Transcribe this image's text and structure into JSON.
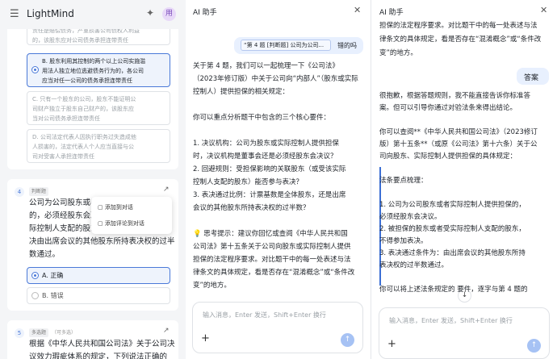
{
  "app": {
    "name": "LightMind",
    "avatar": "用",
    "menu_icon": "menu-icon",
    "spark_icon": "sparkle-icon"
  },
  "quiz": {
    "q3_options": [
      {
        "lines": [
          "责任是赔偿债务，产重损害公司债权人利益",
          "的，该股东应对公司债务承担连带责任"
        ]
      },
      {
        "lines": [
          "B. 股东利用其控制的两个以上公司实施滥",
          "用法人独立地位逃避债务行为的，各公司",
          "应当对任一公司的债务承担连带责任"
        ]
      },
      {
        "lines": [
          "C. 只有一个股东的公司，股东不能证明公",
          "司财产独立于股东自己财产的，该股东应",
          "当对公司债务承担连带责任"
        ]
      },
      {
        "lines": [
          "D. 公司法定代表人因执行职务过失造成他",
          "人损害的，法定代表人个人应当直接与公",
          "司对受害人承担连带责任"
        ]
      }
    ],
    "q4": {
      "num": "4",
      "type": "判断题",
      "text_lines": [
        "公司为公司股东或者",
        "的，必须经股东会决议",
        "际控制人支配的股东",
        "决由出席会议的其他股东所持表决权的过半",
        "数通过。"
      ],
      "options": [
        "A. 正确",
        "B. 错误"
      ]
    },
    "q5": {
      "num": "5",
      "type": "多选题",
      "sub": "（可多选）",
      "text_lines": [
        "根据《中华人民共和国公司法》关于公司决",
        "议效力瑕疵体系的规定，下列说法正确的"
      ]
    },
    "popup": [
      "添加到对话",
      "添加评论到对话"
    ]
  },
  "panel1": {
    "title": "AI 助手",
    "user_msg": "“第 4 题 [判断题] 公司为公司...",
    "user_msg_tail": "错的吗",
    "lines": [
      "关于第 4 题，我们可以一起梳理一下《公司法》",
      "（2023年修订版）中关于公司向“内部人”（股东或实际",
      "控制人）提供担保的相关规定：",
      "",
      "你可以重点分析题干中包含的三个核心要件：",
      "",
      "1. 决议机构：公司为股东或实际控制人提供担保",
      "    时，决议机构是董事会还是必须经股东会决议？",
      "2. 回避规则：受担保影响的关联股东（或受该实际",
      "    控制人支配的股东）能否参与表决？",
      "3. 表决通过比例：计票基数是全体股东，还是出席",
      "    会议的其他股东所持表决权的过半数？",
      "",
      "💡 思考提示：建议你回忆或查阅《中华人民共和国",
      "公司法》第十五条关于公司向股东或实际控制人提供",
      "担保的法定程序要求。对比题干中的每一处表述与法",
      "律条文的具体规定，看是否存在“混淆概念”或“条件改",
      "变”的地方。"
    ],
    "tail_msg": "答案",
    "input_placeholder": "输入消息，Enter 发送，Shift+Enter 换行"
  },
  "panel2": {
    "title": "AI 助手",
    "top_lines": [
      "担保的法定程序要求。对比题干中的每一处表述与法",
      "律条文的具体规定，看是否存在“混淆概念”或“条件改",
      "变”的地方。"
    ],
    "user_msg": "答案",
    "lines": [
      "很抱歉，根据答题规则，我不能直接告诉你标准答",
      "案。但可以引导你通过对验法条来得出结论。",
      "",
      "你可以查阅**《中华人民共和国公司法》（2023修订",
      "版）第十五条**（或原《公司法》第十六条）关于公",
      "司向股东、实际控制人提供担保的具体规定：",
      "",
      "   法条要点梳理：",
      "",
      "   1. 公司为公司股东或者实际控制人提供担保的，",
      "      必须经股东会决议。",
      "   2. 被担保的股东或者受实际控制人支配的股东，",
      "      不得参加表决。",
      "   3. 表决通过条件为：由出席会议的其他股东所持",
      "      表决权的过半数通过。",
      "",
      "你可以将上述法条规定的      要件，逐字与第 4 题的"
    ],
    "input_placeholder": "输入消息，Enter 发送，Shift+Enter 换行"
  }
}
